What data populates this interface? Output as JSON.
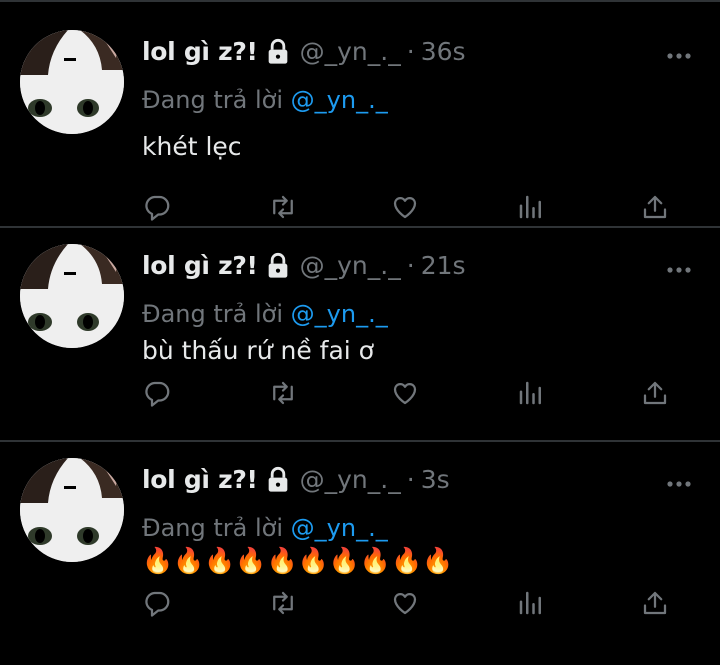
{
  "tweets": [
    {
      "name": "lol gì z?!",
      "handle": "@_yn_._",
      "separator": "·",
      "time": "36s",
      "reply_prefix": "Đang trả lời",
      "reply_to": "@_yn_._",
      "text": "khét lẹc"
    },
    {
      "name": "lol gì z?!",
      "handle": "@_yn_._",
      "separator": "·",
      "time": "21s",
      "reply_prefix": "Đang trả lời",
      "reply_to": "@_yn_._",
      "text": "bù thấu rứ nề fai ơ"
    },
    {
      "name": "lol gì z?!",
      "handle": "@_yn_._",
      "separator": "·",
      "time": "3s",
      "reply_prefix": "Đang trả lời",
      "reply_to": "@_yn_._",
      "text": "🔥🔥🔥🔥🔥🔥🔥🔥🔥🔥"
    }
  ],
  "icons": {
    "lock": "lock-icon",
    "more": "more-icon",
    "reply": "reply-icon",
    "retweet": "retweet-icon",
    "like": "heart-icon",
    "views": "views-icon",
    "share": "share-icon"
  },
  "colors": {
    "background": "#000000",
    "primary_text": "#e7e9ea",
    "secondary_text": "#71767b",
    "accent": "#1d9bf0",
    "separator": "#2f3336"
  }
}
